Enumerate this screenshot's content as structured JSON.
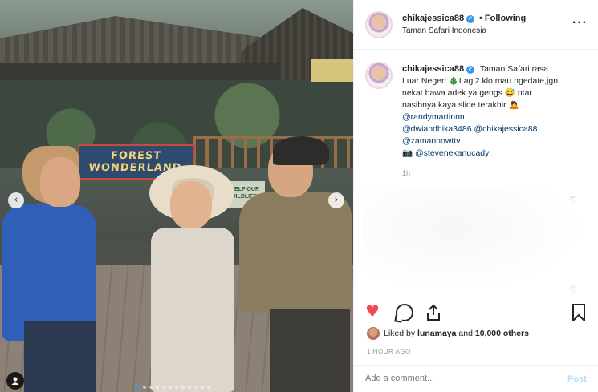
{
  "photo": {
    "sign_line1": "FOREST",
    "sign_line2": "WONDERLAND",
    "sign_small": "HELP OUR WILDLIFE",
    "carousel_dots": 12,
    "active_dot": 0
  },
  "header": {
    "username": "chikajessica88",
    "verified": true,
    "separator": "•",
    "follow_status": "Following",
    "location": "Taman Safari Indonesia"
  },
  "caption": {
    "username": "chikajessica88",
    "text_1": "Taman Safari rasa Luar Negeri 🎄Lagi2 klo mau ngedate,jgn nekat bawa adek ya gengs 😅 ntar nasibnya kaya slide terakhir 🙇",
    "mention_1": "@randymartinnn",
    "mention_2": "@dwiandhika3486",
    "mention_3": "@chikajessica88",
    "mention_4": "@zamannowttv",
    "camera_icon": "📷",
    "mention_5": "@stevenekanucady",
    "time": "1h"
  },
  "likes": {
    "liked_by": "Liked by",
    "user": "lunamaya",
    "and": "and",
    "others": "10,000 others"
  },
  "timestamp": "1 HOUR AGO",
  "comment": {
    "placeholder": "Add a comment...",
    "post_label": "Post"
  },
  "colors": {
    "like": "#ed4956",
    "link": "#003569",
    "verified": "#3897f0"
  }
}
